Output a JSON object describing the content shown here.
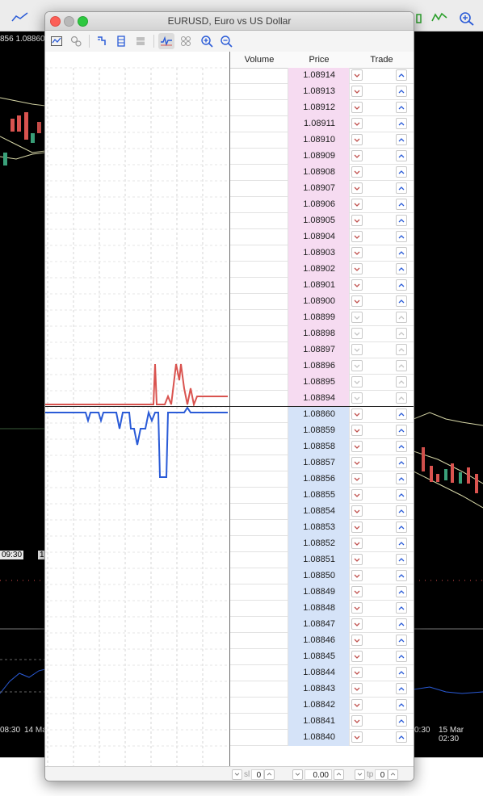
{
  "window": {
    "title": "EURUSD, Euro vs US Dollar"
  },
  "background": {
    "price_label": "856 1.08860",
    "dates": {
      "left_box": "09:30",
      "left_box2": "1",
      "left_bottom_time": "08:30",
      "left_bottom_date": "14 Ma",
      "right_bottom_time": "0:30",
      "right_bottom_date": "15 Mar 02:30"
    }
  },
  "toolbar": {
    "icons": [
      "chart-settings-icon",
      "one-click-icon",
      "depth-icon",
      "levels-icon",
      "hide-icon",
      "line-chart-icon",
      "tick-icon",
      "zoom-in-icon",
      "zoom-out-icon"
    ]
  },
  "table": {
    "headers": {
      "volume": "Volume",
      "price": "Price",
      "trade": "Trade"
    },
    "ask_prices": [
      "1.08914",
      "1.08913",
      "1.08912",
      "1.08911",
      "1.08910",
      "1.08909",
      "1.08908",
      "1.08907",
      "1.08906",
      "1.08905",
      "1.08904",
      "1.08903",
      "1.08902",
      "1.08901",
      "1.08900",
      "1.08899",
      "1.08898",
      "1.08897",
      "1.08896",
      "1.08895",
      "1.08894"
    ],
    "bid_prices": [
      "1.08860",
      "1.08859",
      "1.08858",
      "1.08857",
      "1.08856",
      "1.08855",
      "1.08854",
      "1.08853",
      "1.08852",
      "1.08851",
      "1.08850",
      "1.08849",
      "1.08848",
      "1.08847",
      "1.08846",
      "1.08845",
      "1.08844",
      "1.08843",
      "1.08842",
      "1.08841",
      "1.08840"
    ]
  },
  "controls": {
    "sl_label": "sl",
    "sl_value": "0",
    "volume_value": "0.00",
    "tp_label": "tp",
    "tp_value": "0"
  },
  "colors": {
    "ask_row": "#f6dbf1",
    "bid_row": "#d5e3f8",
    "ask_line": "#d9534f",
    "bid_line": "#2a5bd7"
  }
}
